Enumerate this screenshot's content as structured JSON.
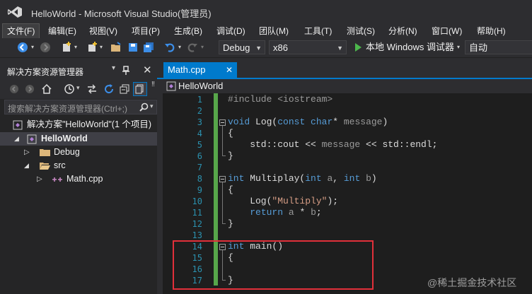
{
  "window": {
    "title": "HelloWorld - Microsoft Visual Studio(管理员)"
  },
  "menu": [
    "文件(F)",
    "编辑(E)",
    "视图(V)",
    "项目(P)",
    "生成(B)",
    "调试(D)",
    "团队(M)",
    "工具(T)",
    "测试(S)",
    "分析(N)",
    "窗口(W)",
    "帮助(H)"
  ],
  "toolbar": {
    "config": "Debug",
    "platform": "x86",
    "run_label": "本地 Windows 调试器",
    "run_mode": "自动"
  },
  "solution_explorer": {
    "title": "解决方案资源管理器",
    "search_placeholder": "搜索解决方案资源管理器(Ctrl+;)",
    "tree": [
      {
        "label": "解决方案\"HelloWorld\"(1 个项目)",
        "icon": "solution-icon"
      },
      {
        "label": "HelloWorld",
        "icon": "project-icon",
        "bold": true
      },
      {
        "label": "Debug",
        "icon": "folder-icon"
      },
      {
        "label": "src",
        "icon": "folder-icon"
      },
      {
        "label": "Math.cpp",
        "icon": "cpp-file-icon"
      }
    ]
  },
  "editor": {
    "tab_label": "Math.cpp",
    "nav_scope": "HelloWorld",
    "line_numbers": [
      "1",
      "2",
      "3",
      "4",
      "5",
      "6",
      "7",
      "8",
      "9",
      "10",
      "11",
      "12",
      "13",
      "14",
      "15",
      "16",
      "17"
    ]
  },
  "watermark": "@稀土掘金技术社区",
  "colors": {
    "accent": "#007acc",
    "highlight_box": "#e1303a",
    "gutter_changed": "#57a64a"
  }
}
